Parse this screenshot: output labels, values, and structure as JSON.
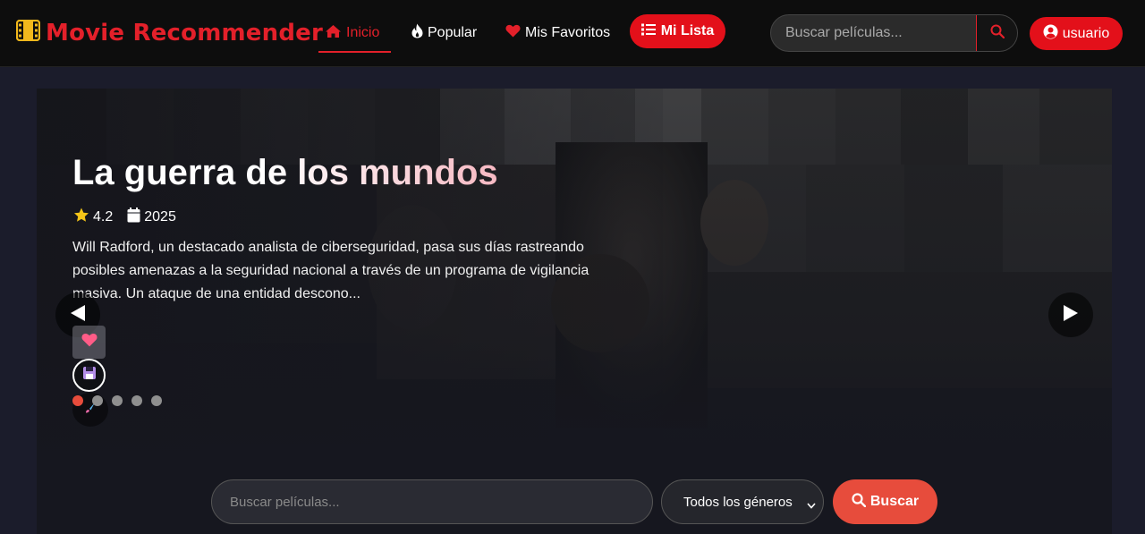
{
  "navbar": {
    "brand": "Movie Recommender",
    "brand_icon": "film-icon",
    "links": [
      {
        "label": "Inicio",
        "icon": "home-icon",
        "active": true
      },
      {
        "label": "Popular",
        "icon": "fire-icon",
        "active": false
      },
      {
        "label": "Mis Favoritos",
        "icon": "heart-icon",
        "active": false
      }
    ],
    "my_list_label": "Mi Lista",
    "search_placeholder": "Buscar películas...",
    "user_label": "usuario",
    "accent_color": "#e3101a"
  },
  "hero": {
    "title": "La guerra de los mundos",
    "rating": "4.2",
    "year": "2025",
    "description": "Will Radford, un destacado analista de ciberseguridad, pasa sus días rastreando posibles amenazas a la seguridad nacional a través de un programa de vigilancia masiva. Un ataque de una entidad descono...",
    "slide_count": 5,
    "active_slide": 1
  },
  "filters": {
    "search_placeholder": "Buscar películas...",
    "genre_selected": "Todos los géneros",
    "search_button_label": "Buscar",
    "button_color": "#e74c3c"
  }
}
